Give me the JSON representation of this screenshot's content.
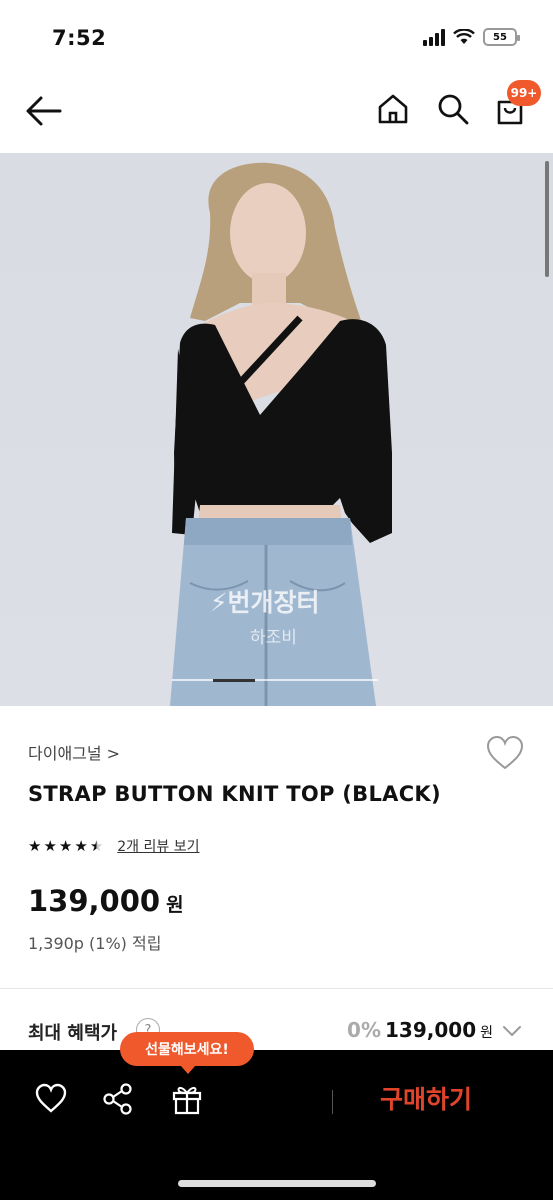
{
  "status_bar": {
    "time": "7:52",
    "battery": "55"
  },
  "header": {
    "back_icon": "arrow-left-icon",
    "home_icon": "home-icon",
    "search_icon": "search-icon",
    "cart_icon": "shopping-bag-icon",
    "cart_badge": "99+",
    "badge_color": "#f0592b"
  },
  "image": {
    "watermark": "⚡번개장터",
    "watermark_sub": "하조비"
  },
  "product": {
    "brand": "다이애그널 >",
    "name": "STRAP BUTTON KNIT TOP (BLACK)",
    "rating": 4.5,
    "stars": [
      "★",
      "★",
      "★",
      "★",
      "★"
    ],
    "review_link": "2개 리뷰 보기",
    "price": "139,000",
    "price_unit": "원",
    "points": "1,390p (1%) 적립"
  },
  "benefit": {
    "label": "최대 혜택가",
    "help": "?",
    "percent": "0%",
    "price": "139,000",
    "unit": "원"
  },
  "bottom_bar": {
    "tooltip": "선물해보세요!",
    "heart_icon": "heart-outline-icon",
    "share_icon": "share-icon",
    "gift_icon": "gift-icon",
    "buy_label": "구매하기",
    "accent": "#e0452b"
  }
}
